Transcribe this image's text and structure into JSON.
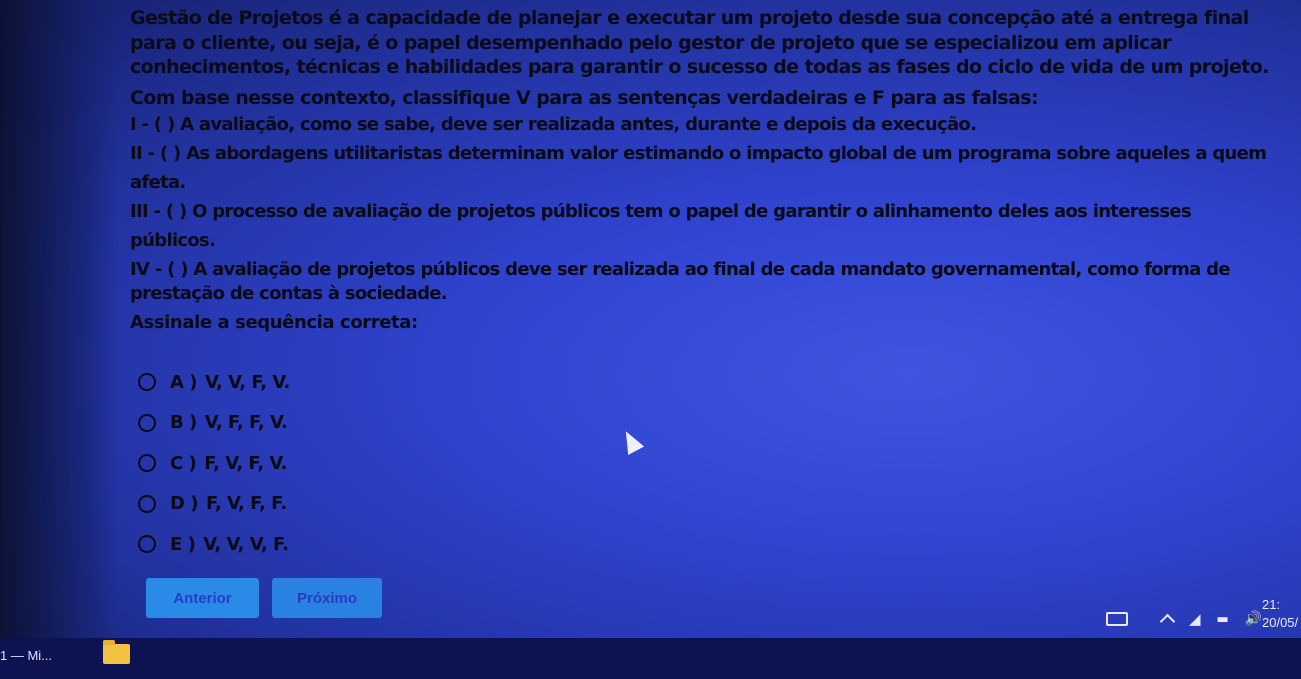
{
  "question": {
    "intro": "Gestão de Projetos é a capacidade de planejar e executar um projeto desde sua concepção até a entrega final para o cliente, ou seja, é o papel desempenhado pelo gestor de projeto que se especializou em aplicar conhecimentos, técnicas e habilidades para garantir o sucesso de todas as fases do ciclo de vida de um projeto.",
    "prompt": "Com base nesse contexto, classifique V para as sentenças verdadeiras e F para as falsas:",
    "statements": [
      "I - ( ) A avaliação, como se sabe, deve ser realizada antes, durante e depois da execução.",
      "II - ( ) As abordagens utilitaristas determinam valor estimando o impacto global de um programa sobre aqueles a quem afeta.",
      "III - ( ) O processo de avaliação de projetos públicos tem o papel de garantir o alinhamento deles aos interesses públicos.",
      "IV - ( ) A avaliação de projetos públicos deve ser realizada ao final de cada mandato governamental, como forma de prestação de contas à sociedade."
    ],
    "instruction": "Assinale a sequência correta:"
  },
  "options": [
    {
      "letter": "A )",
      "text": "V, V, F, V."
    },
    {
      "letter": "B )",
      "text": "V, F, F, V."
    },
    {
      "letter": "C )",
      "text": "F, V, F, V."
    },
    {
      "letter": "D )",
      "text": "F, V, F, F."
    },
    {
      "letter": "E )",
      "text": "V, V, V, F."
    }
  ],
  "nav": {
    "prev_label": "Anterior",
    "next_label": "Próximo"
  },
  "taskbar": {
    "item_label": "1 — Mi...",
    "clock_time": "21:",
    "clock_date": "20/05/"
  },
  "colors": {
    "background": "#2f43cf",
    "button": "#2a8ae8",
    "text": "#0b0b18"
  }
}
